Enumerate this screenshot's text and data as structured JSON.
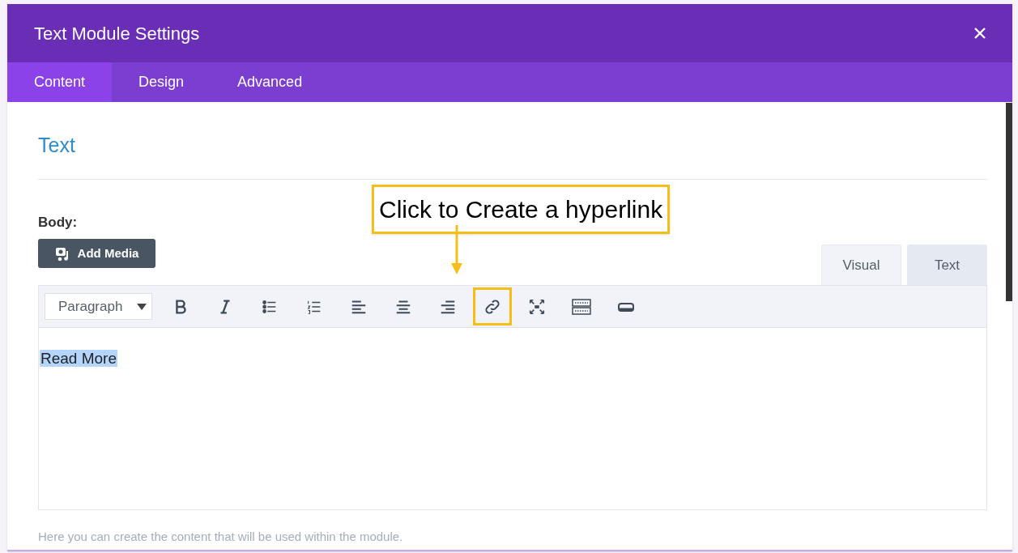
{
  "window": {
    "title": "Text Module Settings"
  },
  "tabs": [
    {
      "label": "Content",
      "selected": true
    },
    {
      "label": "Design",
      "selected": false
    },
    {
      "label": "Advanced",
      "selected": false
    }
  ],
  "section": {
    "title": "Text"
  },
  "field": {
    "label": "Body:",
    "add_media": "Add Media"
  },
  "editor_tabs": [
    {
      "label": "Visual",
      "selected": true
    },
    {
      "label": "Text",
      "selected": false
    }
  ],
  "toolbar": {
    "format": "Paragraph",
    "buttons": [
      {
        "kind": "bold",
        "highlighted": false
      },
      {
        "kind": "italic",
        "highlighted": false
      },
      {
        "kind": "bullets",
        "highlighted": false
      },
      {
        "kind": "numbers",
        "highlighted": false
      },
      {
        "kind": "align-left",
        "highlighted": false
      },
      {
        "kind": "align-center",
        "highlighted": false
      },
      {
        "kind": "align-right",
        "highlighted": false
      },
      {
        "kind": "link",
        "highlighted": true
      },
      {
        "kind": "fullscreen",
        "highlighted": false
      },
      {
        "kind": "keyboard",
        "highlighted": false
      },
      {
        "kind": "more",
        "highlighted": false
      }
    ]
  },
  "content": {
    "text": "Read More",
    "selected": true
  },
  "callout": {
    "text": "Click to Create a hyperlink"
  },
  "help": "Here you can create the content that will be used within the module."
}
